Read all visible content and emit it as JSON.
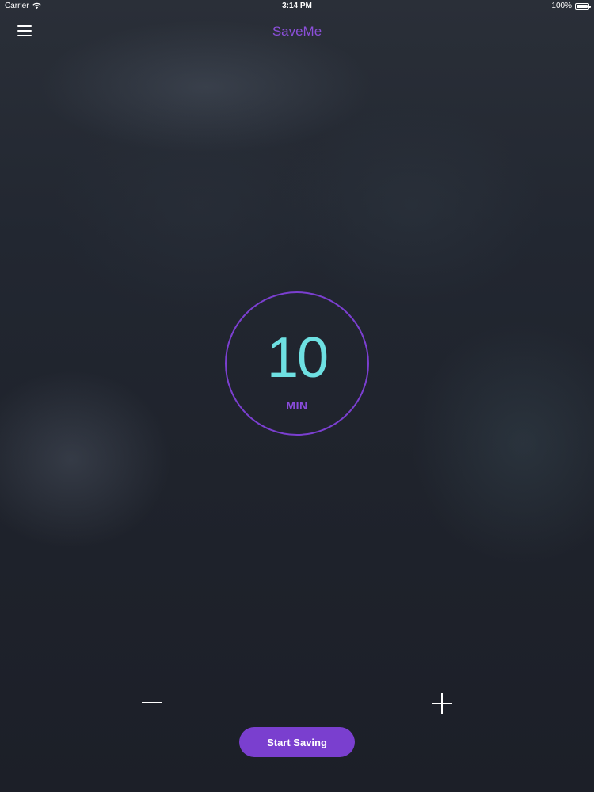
{
  "status_bar": {
    "carrier": "Carrier",
    "time": "3:14 PM",
    "battery": "100%",
    "battery_level": 1.0
  },
  "nav": {
    "title": "SaveMe",
    "menu_icon": "hamburger-menu-icon"
  },
  "timer": {
    "value": "10",
    "unit": "MIN"
  },
  "controls": {
    "minus_icon": "minus-icon",
    "plus_icon": "plus-icon",
    "start_label": "Start Saving"
  },
  "colors": {
    "accent_purple": "#7a3fcf",
    "timer_cyan": "#6ee0e2",
    "background": "#1d212b"
  }
}
